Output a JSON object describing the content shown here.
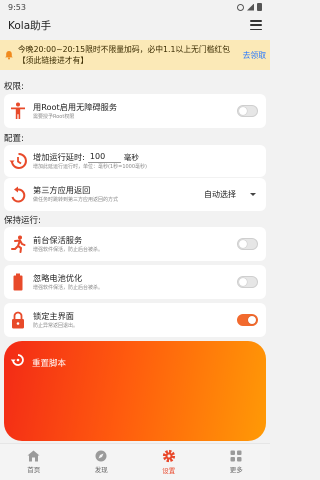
{
  "status": {
    "time": "9:53"
  },
  "app": {
    "title": "Kola助手"
  },
  "notice": {
    "text": "今晚20:00~20:15限时不限量加码，必中1.1以上无门槛红包【须此链接进才有】",
    "link": "去领取"
  },
  "sections": {
    "permissions": "权限:",
    "config": "配置:",
    "keepalive": "保持运行:"
  },
  "items": {
    "root": {
      "label": "用Root启用无障碍服务",
      "desc": "需要授予Root权限",
      "enabled": false
    },
    "delay": {
      "label": "增加运行延时:",
      "value": "100",
      "unit": "毫秒",
      "desc": "增加此延运行运行时，单位：毫秒(1秒=1000毫秒)"
    },
    "thirdparty": {
      "label": "第三方应用返回",
      "value": "自动选择",
      "desc": "做任务时跳转到第三方应用返回的方式"
    },
    "foreground": {
      "label": "前台保活服务",
      "desc": "增强软件保活，防止后台被杀。",
      "enabled": false
    },
    "battery": {
      "label": "忽略电池优化",
      "desc": "增强软件保活，防止后台被杀。",
      "enabled": false
    },
    "lock": {
      "label": "锁定主界面",
      "desc": "防止异常返回退出。",
      "enabled": true
    }
  },
  "reset": {
    "label": "重置脚本"
  },
  "nav": [
    {
      "label": "首页",
      "icon": "home-icon"
    },
    {
      "label": "发现",
      "icon": "discover-icon"
    },
    {
      "label": "设置",
      "icon": "settings-icon",
      "active": true
    },
    {
      "label": "更多",
      "icon": "more-icon"
    }
  ],
  "colors": {
    "accent": "#e9472a",
    "notice_bg": "#fbe9b7",
    "link": "#2979ff",
    "toggle_on": "#f26a2e"
  }
}
